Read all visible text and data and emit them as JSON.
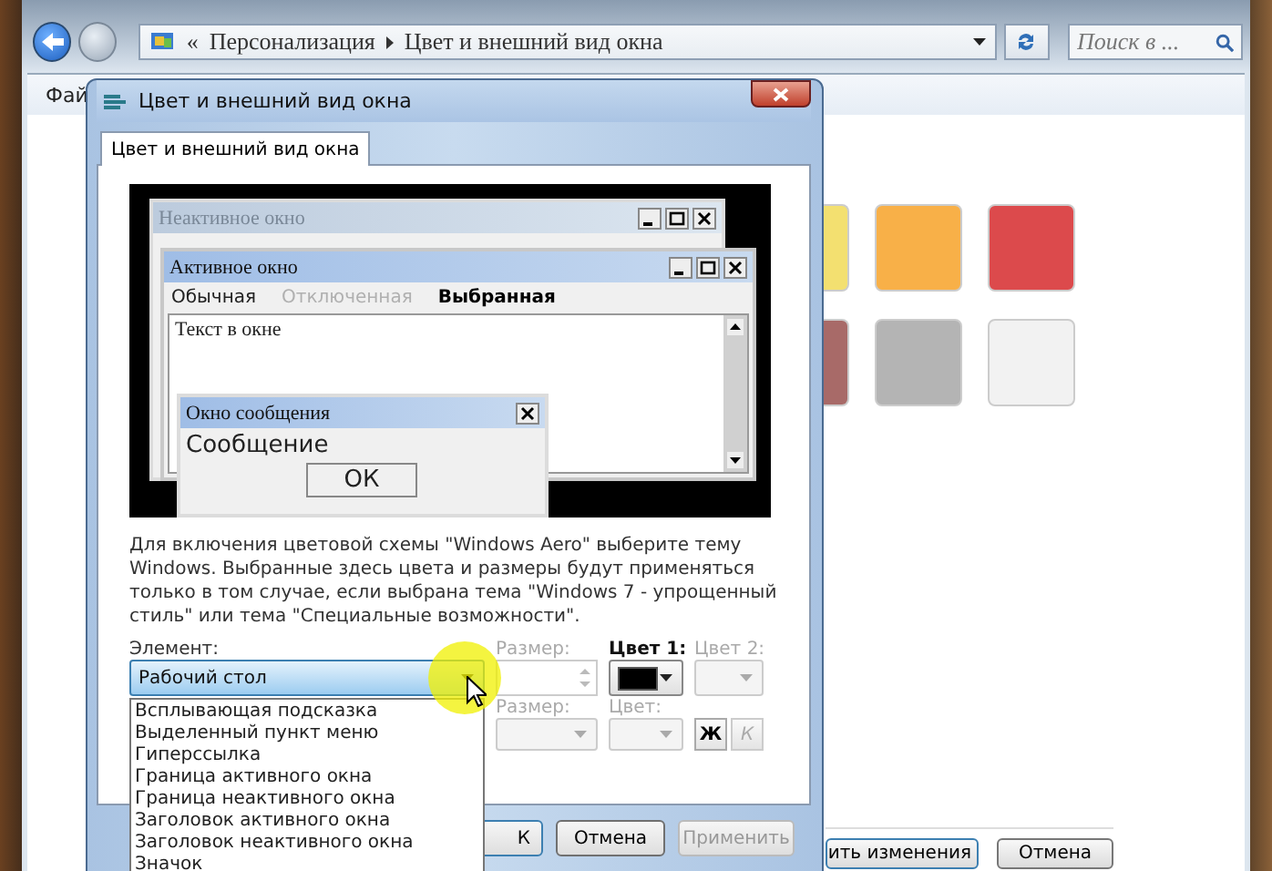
{
  "explorer": {
    "address": {
      "prefix": "«",
      "segments": [
        "Персонализация",
        "Цвет и внешний вид окна"
      ]
    },
    "search": {
      "placeholder": "Поиск в ..."
    },
    "menu": [
      "Фай"
    ],
    "swatches": [
      {
        "color": "#f3e070"
      },
      {
        "color": "#f8b048"
      },
      {
        "color": "#dc4a4c"
      },
      {
        "color": "#a86a68"
      },
      {
        "color": "#b4b4b4"
      },
      {
        "color": "#f2f2f2"
      }
    ],
    "buttons": [
      "ить изменения",
      "Отмена"
    ]
  },
  "dialog": {
    "title": "Цвет и внешний вид окна",
    "tabs": [
      {
        "label": "Цвет и внешний вид окна",
        "selected": true
      }
    ],
    "preview": {
      "inactive_window": {
        "title": "Неактивное окно"
      },
      "active_window": {
        "title": "Активное окно",
        "menu": [
          {
            "label": "Обычная",
            "kind": "normal"
          },
          {
            "label": "Отключенная",
            "kind": "disabled"
          },
          {
            "label": "Выбранная",
            "kind": "selected"
          }
        ],
        "text": "Текст в окне"
      },
      "message_box": {
        "title": "Окно сообщения",
        "text": "Сообщение",
        "button": "ОК"
      }
    },
    "description": "Для включения цветовой схемы \"Windows Aero\" выберите тему Windows. Выбранные здесь цвета и размеры будут применяться только в том случае, если выбрана тема \"Windows 7 - упрощенный стиль\" или тема \"Специальные возможности\".",
    "element": {
      "label": "Элемент:",
      "value": "Рабочий стол",
      "expanded": true,
      "options": [
        "Всплывающая подсказка",
        "Выделенный пункт меню",
        "Гиперссылка",
        "Граница активного окна",
        "Граница неактивного окна",
        "Заголовок активного окна",
        "Заголовок неактивного окна",
        "Значок"
      ]
    },
    "size1": {
      "label": "Размер:",
      "disabled": true
    },
    "color1": {
      "label": "Цвет 1:",
      "disabled": false,
      "color": "#000000"
    },
    "color2": {
      "label": "Цвет 2:",
      "disabled": true
    },
    "size2": {
      "label": "Размер:",
      "disabled": true
    },
    "color3": {
      "label": "Цвет:",
      "disabled": true
    },
    "bold": {
      "label": "Ж",
      "disabled": false
    },
    "italic": {
      "label": "К",
      "disabled": true
    },
    "buttons": [
      {
        "label": "К",
        "disabled": false
      },
      {
        "label": "Отмена",
        "disabled": false
      },
      {
        "label": "Применить",
        "disabled": true
      }
    ]
  }
}
